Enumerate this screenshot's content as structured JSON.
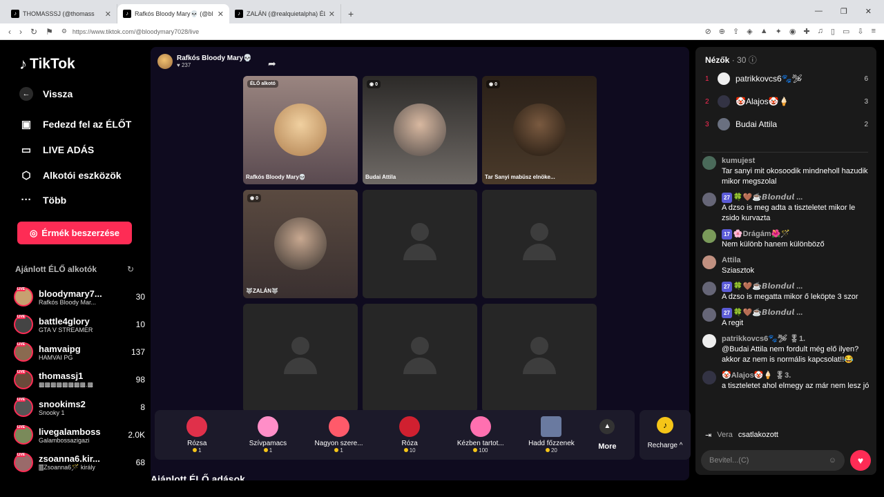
{
  "browser": {
    "tabs": [
      {
        "label": "THOMASSSJ (@thomass",
        "active": false
      },
      {
        "label": "Rafkós Bloody Mary💀 (@bl",
        "active": true
      },
      {
        "label": "ZALÁN (@realquietalpha) ÉLŐ",
        "active": false
      }
    ],
    "url": "https://www.tiktok.com/@bloodymary7028/live"
  },
  "sidebar": {
    "logo": "TikTok",
    "back_label": "Vissza",
    "nav": [
      {
        "label": "Fedezd fel az ÉLŐT",
        "icon": "live-explore-icon"
      },
      {
        "label": "LIVE ADÁS",
        "icon": "camera-icon"
      },
      {
        "label": "Alkotói eszközök",
        "icon": "creator-tools-icon"
      },
      {
        "label": "Több",
        "icon": "more-icon"
      }
    ],
    "coins_button": "Érmék beszerzése",
    "recommended_title": "Ajánlott ÉLŐ alkotók",
    "recommended": [
      {
        "name": "bloodymary7...",
        "sub": "Rafkós Bloody Mar...",
        "count": "30",
        "color": "#c8a070"
      },
      {
        "name": "battle4glory",
        "sub": "GTA V STREAMER",
        "count": "10",
        "color": "#444"
      },
      {
        "name": "hamvaipg",
        "sub": "HAMVAI PG",
        "count": "137",
        "color": "#8a6a50"
      },
      {
        "name": "thomassj1",
        "sub": "▩▩▩▩▩▩▩▩.▩",
        "count": "98",
        "color": "#6a4a3a"
      },
      {
        "name": "snookims2",
        "sub": "Snooky 1",
        "count": "8",
        "color": "#555"
      },
      {
        "name": "livegalamboss",
        "sub": "Galambossazigazi",
        "count": "2.0K",
        "color": "#7a8a5a"
      },
      {
        "name": "zsoanna6.kir...",
        "sub": "🀫Zsoanna6🪄 király",
        "count": "68",
        "color": "#9a6a6a"
      }
    ]
  },
  "stream": {
    "host_name": "Rafkós Bloody Mary💀",
    "host_likes": "237",
    "cells": [
      {
        "badge": "ÉLŐ alkotó",
        "name": "Rafkós Bloody Mary💀",
        "filled": true
      },
      {
        "badge": "0",
        "name": "Budai Attila",
        "filled": true
      },
      {
        "badge": "0",
        "name": "Tar Sanyi mabüsz elnöke...",
        "filled": true
      },
      {
        "badge": "0",
        "name": "🐺ZALÁN🐺",
        "filled": true
      },
      {
        "badge": "",
        "name": "",
        "filled": false
      },
      {
        "badge": "",
        "name": "",
        "filled": false
      },
      {
        "badge": "",
        "name": "",
        "filled": false
      },
      {
        "badge": "",
        "name": "",
        "filled": false
      },
      {
        "badge": "",
        "name": "",
        "filled": false
      }
    ],
    "gifts": [
      {
        "name": "Rózsa",
        "price": "1",
        "color": "#e0304a"
      },
      {
        "name": "Szívpamacs",
        "price": "1",
        "color": "#ff8ec8"
      },
      {
        "name": "Nagyon szere...",
        "price": "1",
        "color": "#ff5a6a"
      },
      {
        "name": "Róza",
        "price": "10",
        "color": "#d02030"
      },
      {
        "name": "Kézben tartot...",
        "price": "100",
        "color": "#ff70b0"
      },
      {
        "name": "Hadd főzzenek",
        "price": "20",
        "color": "#6a7aa0"
      }
    ],
    "more_label": "More",
    "recharge_label": "Recharge",
    "below_title": "Ajánlott ÉLŐ adások"
  },
  "viewers": {
    "title": "Nézők",
    "count": "30",
    "top": [
      {
        "rank": "1",
        "name": "patrikkovcs6🐾🛩",
        "score": "6"
      },
      {
        "rank": "2",
        "name": "🤡Alajos🤡🍦",
        "score": "3"
      },
      {
        "rank": "3",
        "name": "Budai Attila",
        "score": "2"
      }
    ]
  },
  "chat": [
    {
      "user": "kumujest",
      "level": "",
      "text": "Tar sanyi mit okosoodik mindneholl hazudik mikor megszolal"
    },
    {
      "user": "🍀🤎☕𝘽𝙡𝙤𝙣𝙙𝙪𝙡 ...",
      "level": "27",
      "text": "A dzso is meg adta a tiszteletet mikor le zsido kurvazta"
    },
    {
      "user": "🌸Drágám🌺🪄",
      "level": "17",
      "text": "Nem különb hanem különböző"
    },
    {
      "user": "Attila",
      "level": "",
      "text": "Sziasztok"
    },
    {
      "user": "🍀🤎☕𝘽𝙡𝙤𝙣𝙙𝙪𝙡 ...",
      "level": "27",
      "text": "A dzso is megatta mikor ő leköpte 3 szor"
    },
    {
      "user": "🍀🤎☕𝘽𝙡𝙤𝙣𝙙𝙪𝙡 ...",
      "level": "27",
      "text": "A regit"
    },
    {
      "user": "patrikkovcs6🐾🛩 🎖1.",
      "level": "",
      "text": "@Budai Attila nem fordult még elő ilyen? akkor az nem is normális kapcsolat!!😂"
    },
    {
      "user": "🤡Alajos🤡🍦 🎖3.",
      "level": "",
      "text": "a tiszteletet ahol elmegy az már nem lesz jó"
    }
  ],
  "join": {
    "user": "Vera",
    "text": "csatlakozott"
  },
  "input_placeholder": "Bevitel...(C)"
}
